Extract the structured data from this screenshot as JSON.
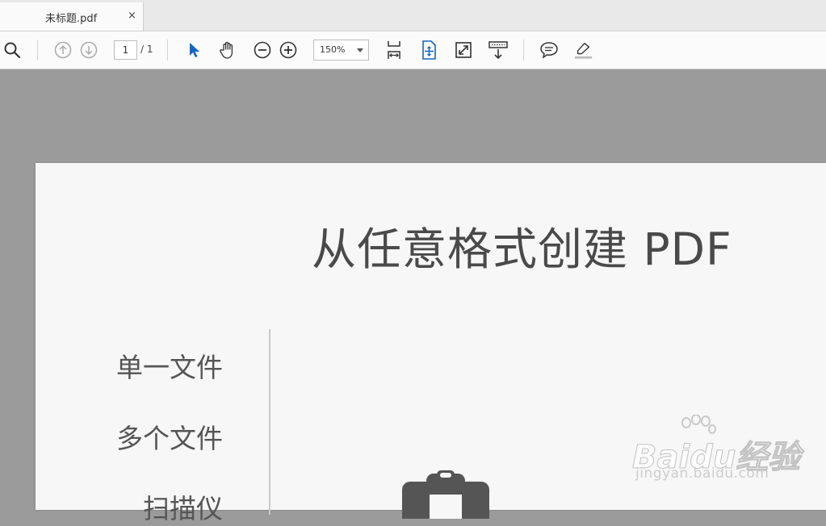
{
  "tab": {
    "title": "未标题.pdf",
    "close": "×"
  },
  "toolbar": {
    "page_current": "1",
    "page_total": "/ 1",
    "zoom": "150%"
  },
  "icons": [
    "search-icon",
    "page-up-icon",
    "page-down-icon",
    "select-arrow-icon",
    "hand-icon",
    "zoom-out-icon",
    "zoom-in-icon",
    "fit-page-icon",
    "scroll-mode-icon",
    "full-screen-icon",
    "read-mode-icon",
    "comment-icon",
    "highlight-icon"
  ],
  "document": {
    "title": "从任意格式创建 PDF",
    "menu": [
      "单一文件",
      "多个文件",
      "扫描仪"
    ]
  },
  "watermark": {
    "brand": "Baidu经验",
    "url": "jingyan.baidu.com"
  },
  "colors": {
    "accent_blue": "#1565c0",
    "toolbar_bg": "#fbfbfb",
    "viewer_bg": "#9b9b9b"
  }
}
